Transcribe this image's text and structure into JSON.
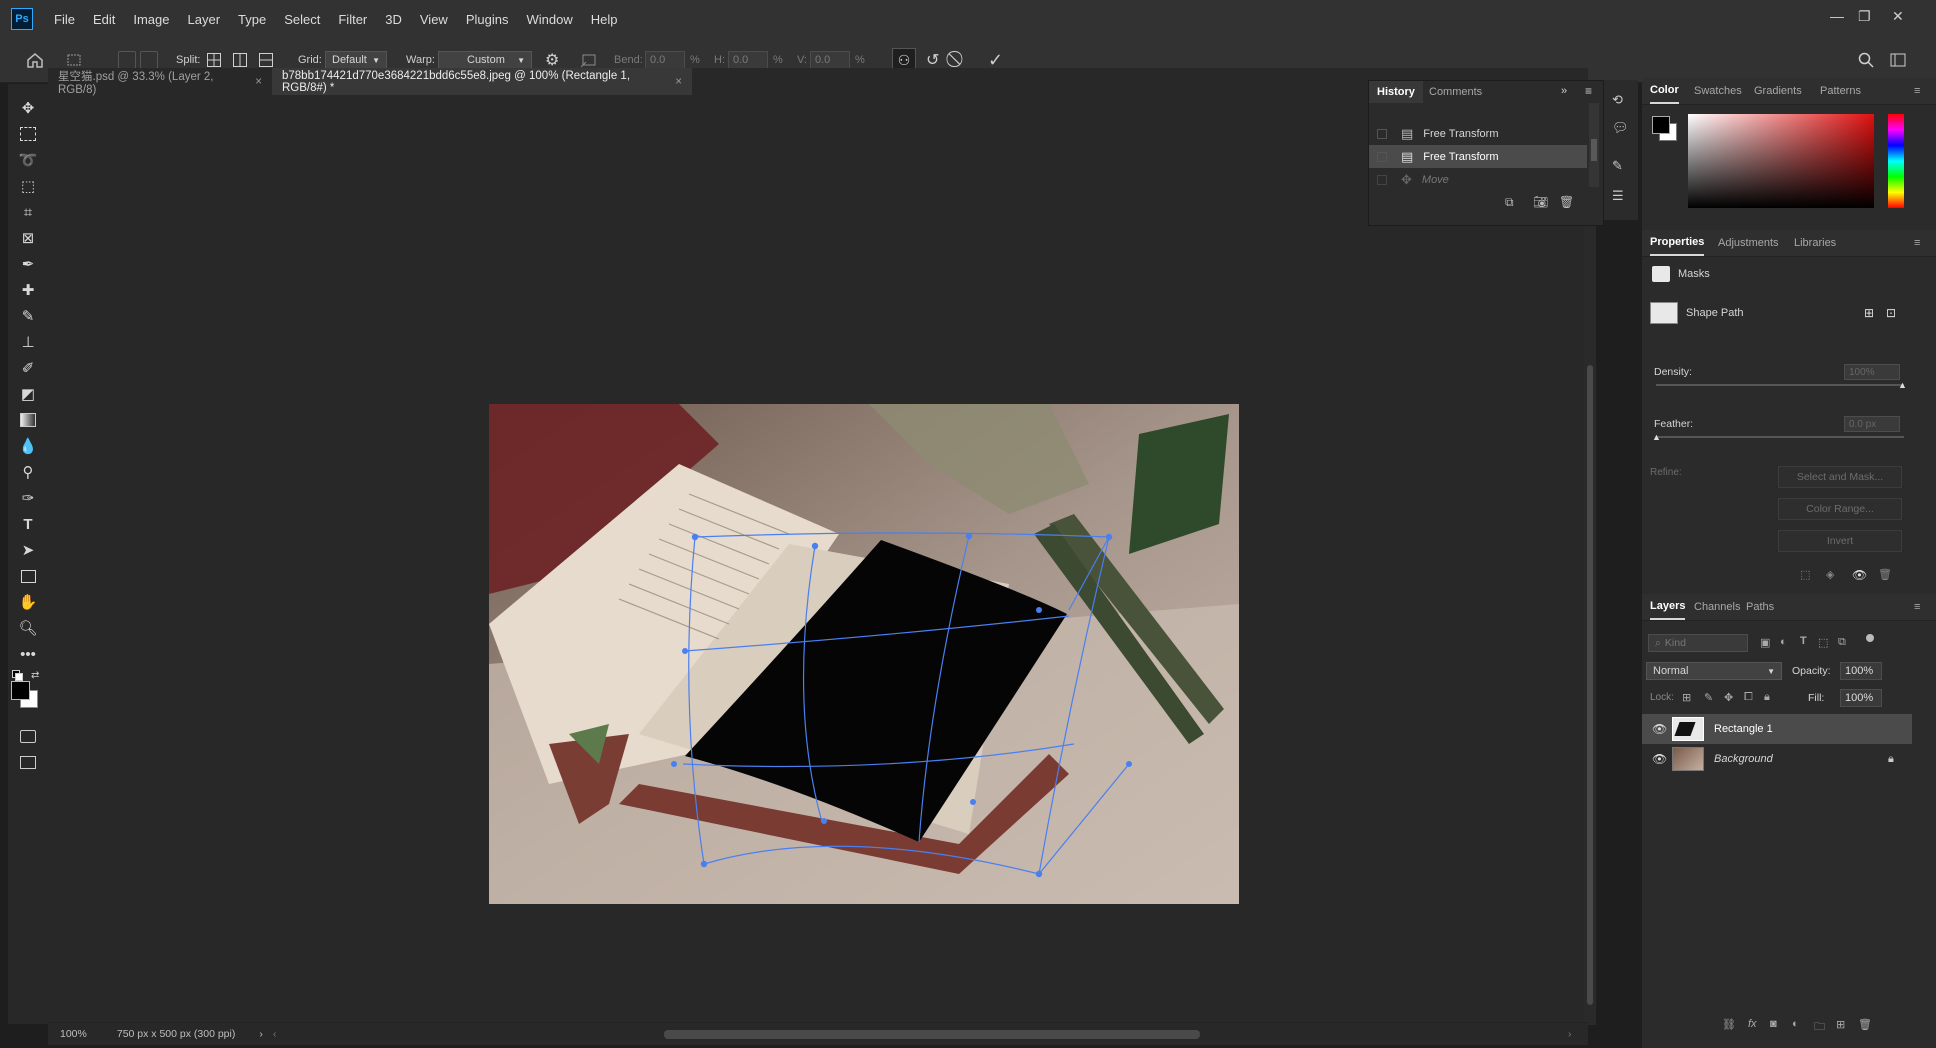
{
  "menubar": {
    "logo": "Ps",
    "items": [
      "File",
      "Edit",
      "Image",
      "Layer",
      "Type",
      "Select",
      "Filter",
      "3D",
      "View",
      "Plugins",
      "Window",
      "Help"
    ]
  },
  "options": {
    "split_label": "Split:",
    "grid_label": "Grid:",
    "grid_value": "Default",
    "warp_label": "Warp:",
    "warp_value": "Custom",
    "bend_label": "Bend:",
    "bend_value": "0.0",
    "h_label": "H:",
    "h_value": "0.0",
    "v_label": "V:",
    "v_value": "0.0",
    "percent": "%"
  },
  "tabs": [
    {
      "label": "星空猫.psd @ 33.3% (Layer 2, RGB/8)",
      "active": false
    },
    {
      "label": "b78bb174421d770e3684221bdd6c55e8.jpeg @ 100% (Rectangle 1, RGB/8#) *",
      "active": true
    }
  ],
  "status": {
    "zoom": "100%",
    "doc_info": "750 px x 500 px (300 ppi)"
  },
  "history": {
    "tabs": [
      "History",
      "Comments"
    ],
    "items": [
      {
        "label": "Free Transform",
        "selected": false,
        "greyed": false
      },
      {
        "label": "Free Transform",
        "selected": true,
        "greyed": false
      },
      {
        "label": "Move",
        "selected": false,
        "greyed": true
      }
    ]
  },
  "color_panel": {
    "tabs": [
      "Color",
      "Swatches",
      "Gradients",
      "Patterns"
    ],
    "fg_color": "#000000",
    "bg_color": "#ffffff",
    "base_hue": "#e01010"
  },
  "properties": {
    "tabs": [
      "Properties",
      "Adjustments",
      "Libraries"
    ],
    "masks_label": "Masks",
    "shape_path_label": "Shape Path",
    "density_label": "Density:",
    "density_value": "100%",
    "feather_label": "Feather:",
    "feather_value": "0.0 px",
    "refine_label": "Refine:",
    "select_and_mask": "Select and Mask...",
    "color_range": "Color Range...",
    "invert": "Invert"
  },
  "layers": {
    "tabs": [
      "Layers",
      "Channels",
      "Paths"
    ],
    "kind_placeholder": "Kind",
    "blend_mode": "Normal",
    "opacity_label": "Opacity:",
    "opacity_value": "100%",
    "lock_label": "Lock:",
    "fill_label": "Fill:",
    "fill_value": "100%",
    "items": [
      {
        "name": "Rectangle 1",
        "selected": true,
        "locked": false
      },
      {
        "name": "Background",
        "selected": false,
        "locked": true
      }
    ]
  },
  "colors": {
    "accent": "#4a7ff0",
    "panel_bg": "#2b2b2b",
    "canvas_bg": "#282828"
  }
}
